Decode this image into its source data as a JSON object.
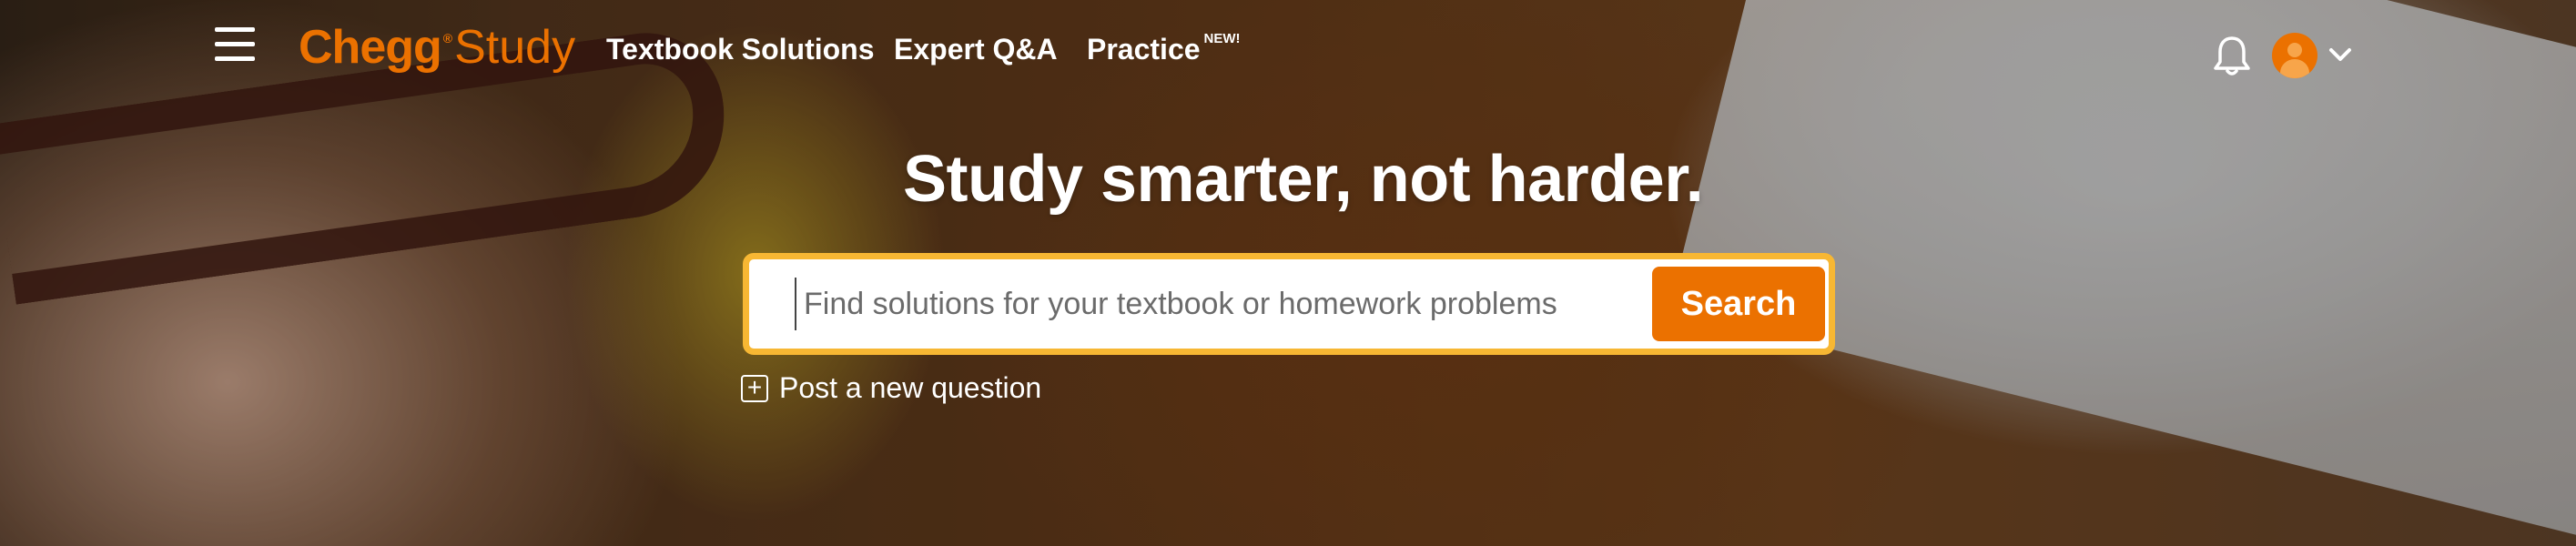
{
  "header": {
    "menu_icon": "hamburger-menu-icon",
    "logo": {
      "brand": "Chegg",
      "registered": "®",
      "product": "Study"
    },
    "nav": [
      {
        "label": "Textbook Solutions"
      },
      {
        "label": "Expert Q&A"
      },
      {
        "label": "Practice",
        "badge": "NEW!"
      }
    ],
    "notification_icon": "bell-icon",
    "avatar_icon": "user-avatar-icon",
    "account_menu_icon": "chevron-down-icon"
  },
  "main": {
    "headline": "Study smarter, not harder.",
    "search": {
      "placeholder": "Find solutions for your textbook or homework problems",
      "value": "",
      "button_label": "Search"
    },
    "post_question": {
      "icon": "plus-square-icon",
      "label": "Post a new question"
    }
  },
  "colors": {
    "brand_orange": "#eb7100",
    "search_border": "#f7b733",
    "text_on_hero": "#ffffff"
  }
}
